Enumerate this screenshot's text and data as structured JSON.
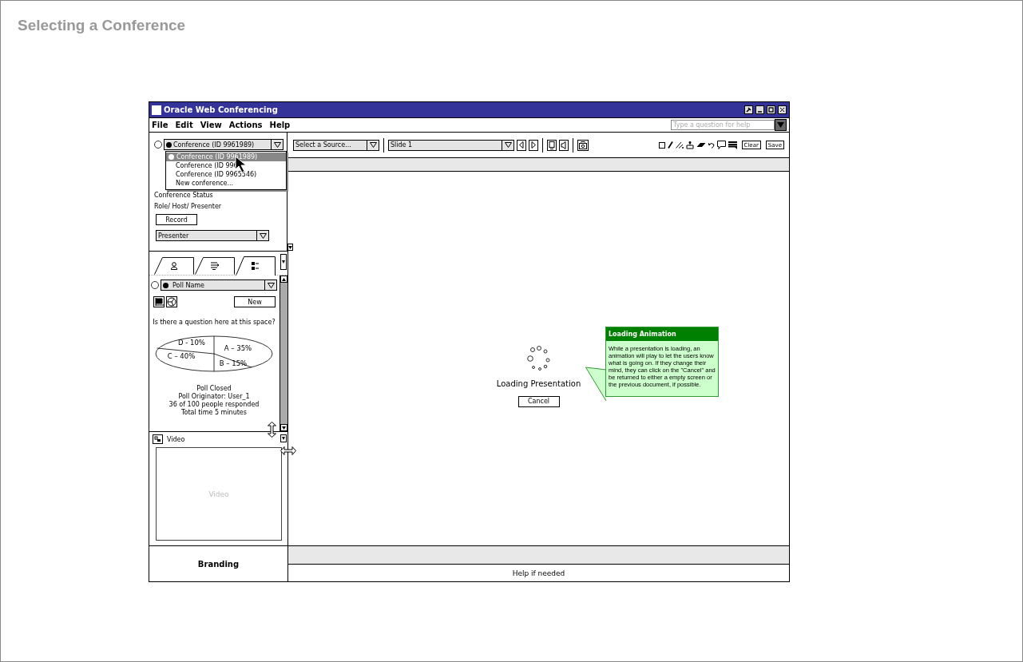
{
  "page_title": "Selecting a Conference",
  "window": {
    "title": "Oracle Web Conferencing"
  },
  "menu": [
    "File",
    "Edit",
    "View",
    "Actions",
    "Help"
  ],
  "help_search": {
    "placeholder": "Type a question for help"
  },
  "conference": {
    "checked": false,
    "value": "Conference (ID 9961989)",
    "options": [
      {
        "label": "Conference (ID 9961989)",
        "selected": true
      },
      {
        "label": "Conference (ID 996",
        "selected": false
      },
      {
        "label": "Conference (ID 9965546)",
        "selected": false
      },
      {
        "label": "New conference...",
        "selected": false
      }
    ],
    "status_label": "Conference Status",
    "role": "Role/ Host/ Presenter",
    "record_button": "Record",
    "role_select": "Presenter"
  },
  "panel_tabs": [
    {
      "kind": "person",
      "selected": false
    },
    {
      "kind": "list",
      "selected": false
    },
    {
      "kind": "poll",
      "selected": true
    }
  ],
  "poll": {
    "checked": false,
    "name": "Poll Name",
    "new_button": "New",
    "question": "Is there a question here at this space?",
    "pie_labels": [
      "A – 35%",
      "B – 15%",
      "C – 40%",
      "D - 10%"
    ],
    "status": [
      "Poll Closed",
      "Poll Originator: User_1",
      "36 of 100 people responded",
      "Total time 5 minutes"
    ]
  },
  "video": {
    "title": "Video",
    "label": "Video"
  },
  "toolbar": {
    "source": "Select a Source...",
    "slide": "Slide 1",
    "clear": "Clear",
    "save": "Save"
  },
  "loading": {
    "label": "Loading Presentation",
    "cancel": "Cancel"
  },
  "callout": {
    "title": "Loading Animation",
    "text": "While a presentation is loading, an animation will play to let the users know what is going on. If they change their mind, they can click on the \"Cancel\" and be returned to either a empty screen or the previous document, if possible."
  },
  "footer": {
    "branding": "Branding",
    "help": "Help if needed"
  }
}
